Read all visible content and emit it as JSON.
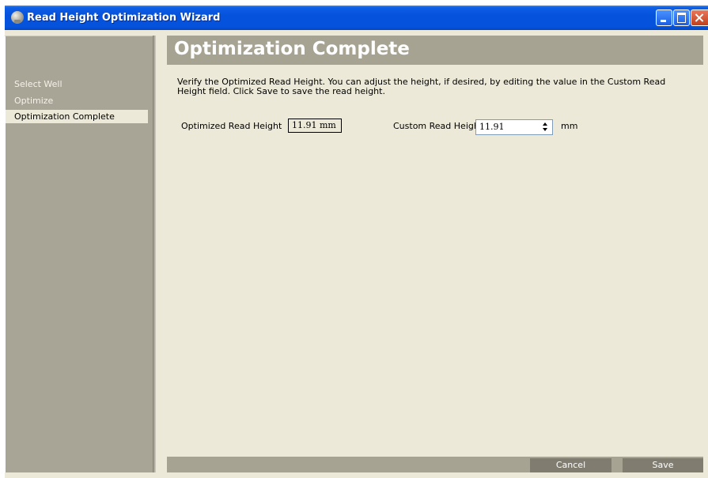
{
  "window": {
    "title": "Read Height Optimization Wizard",
    "app_icon": "disc-icon",
    "controls": [
      "minimize-icon",
      "maximize-icon",
      "close-icon"
    ]
  },
  "sidebar": {
    "items": [
      {
        "label": "Select Well",
        "state": "done"
      },
      {
        "label": "Optimize",
        "state": "done"
      },
      {
        "label": "Optimization Complete",
        "state": "current"
      }
    ]
  },
  "main": {
    "title": "Optimization Complete",
    "instructions": "Verify the Optimized Read Height. You can adjust the height, if desired, by editing the value in the Custom Read Height field. Click Save to save the read height.",
    "optimized_label": "Optimized Read Height",
    "optimized_value": "11.91 mm",
    "custom_label": "Custom Read Height",
    "custom_value": "11.91",
    "unit": "mm"
  },
  "footer": {
    "cancel_label": "Cancel",
    "save_label": "Save"
  },
  "colors": {
    "titlebar": "#0553dc",
    "sidebar": "#a9a596",
    "panel": "#ece9d8",
    "header": "#a7a393",
    "button": "#807d70"
  }
}
